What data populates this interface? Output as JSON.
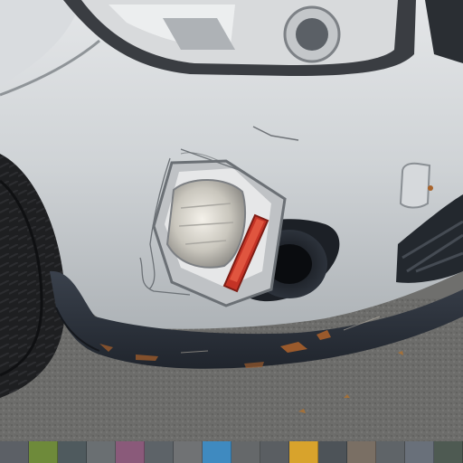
{
  "scene": {
    "subject": "front-bumper-damage",
    "colors": {
      "car_paint": "#d3d6d8",
      "paint_shadow": "#9fa4a8",
      "bumper_trim": "#2b313b",
      "asphalt": "#6f6f6d",
      "tire": "#1f2022",
      "reflector_red": "#c43326",
      "rust": "#9a5a2c"
    },
    "strip_tiles": [
      "#5c6066",
      "#6e8a3a",
      "#4f5a5e",
      "#6a6f72",
      "#8a5a7a",
      "#5d6368",
      "#707274",
      "#3f8ac0",
      "#65686a",
      "#5a5e62",
      "#d8a32c",
      "#4d5358",
      "#7a6f64",
      "#5f6468",
      "#69707a",
      "#4e5a52"
    ]
  }
}
